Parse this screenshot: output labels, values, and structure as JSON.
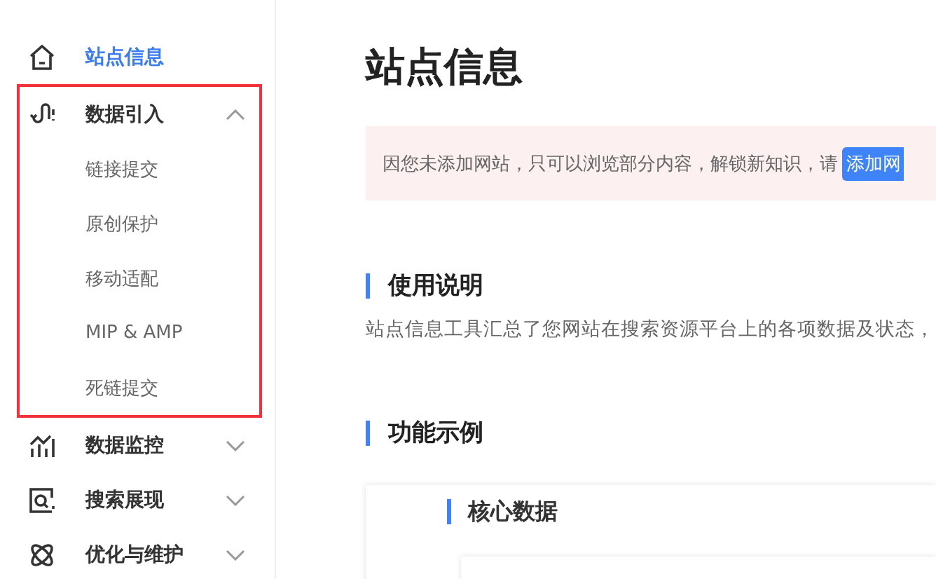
{
  "sidebar": {
    "items": [
      {
        "label": "站点信息",
        "selected": true
      },
      {
        "label": "数据引入",
        "selected": false,
        "expanded": true,
        "highlighted": true,
        "children": [
          {
            "label": "链接提交",
            "selected": false
          },
          {
            "label": "原创保护",
            "selected": false
          },
          {
            "label": "移动适配",
            "selected": false
          },
          {
            "label": "MIP & AMP",
            "selected": false
          },
          {
            "label": "死链提交",
            "selected": false
          }
        ]
      },
      {
        "label": "数据监控",
        "selected": false,
        "expanded": false
      },
      {
        "label": "搜索展现",
        "selected": false,
        "expanded": false
      },
      {
        "label": "优化与维护",
        "selected": false,
        "expanded": false
      }
    ]
  },
  "page": {
    "title": "站点信息",
    "notice": {
      "text": "因您未添加网站，只可以浏览部分内容，解锁新知识，请",
      "button": "添加网"
    },
    "sections": [
      {
        "heading": "使用说明",
        "text": "站点信息工具汇总了您网站在搜索资源平台上的各项数据及状态，"
      },
      {
        "heading": "功能示例",
        "card": {
          "heading": "核心数据"
        }
      }
    ]
  }
}
